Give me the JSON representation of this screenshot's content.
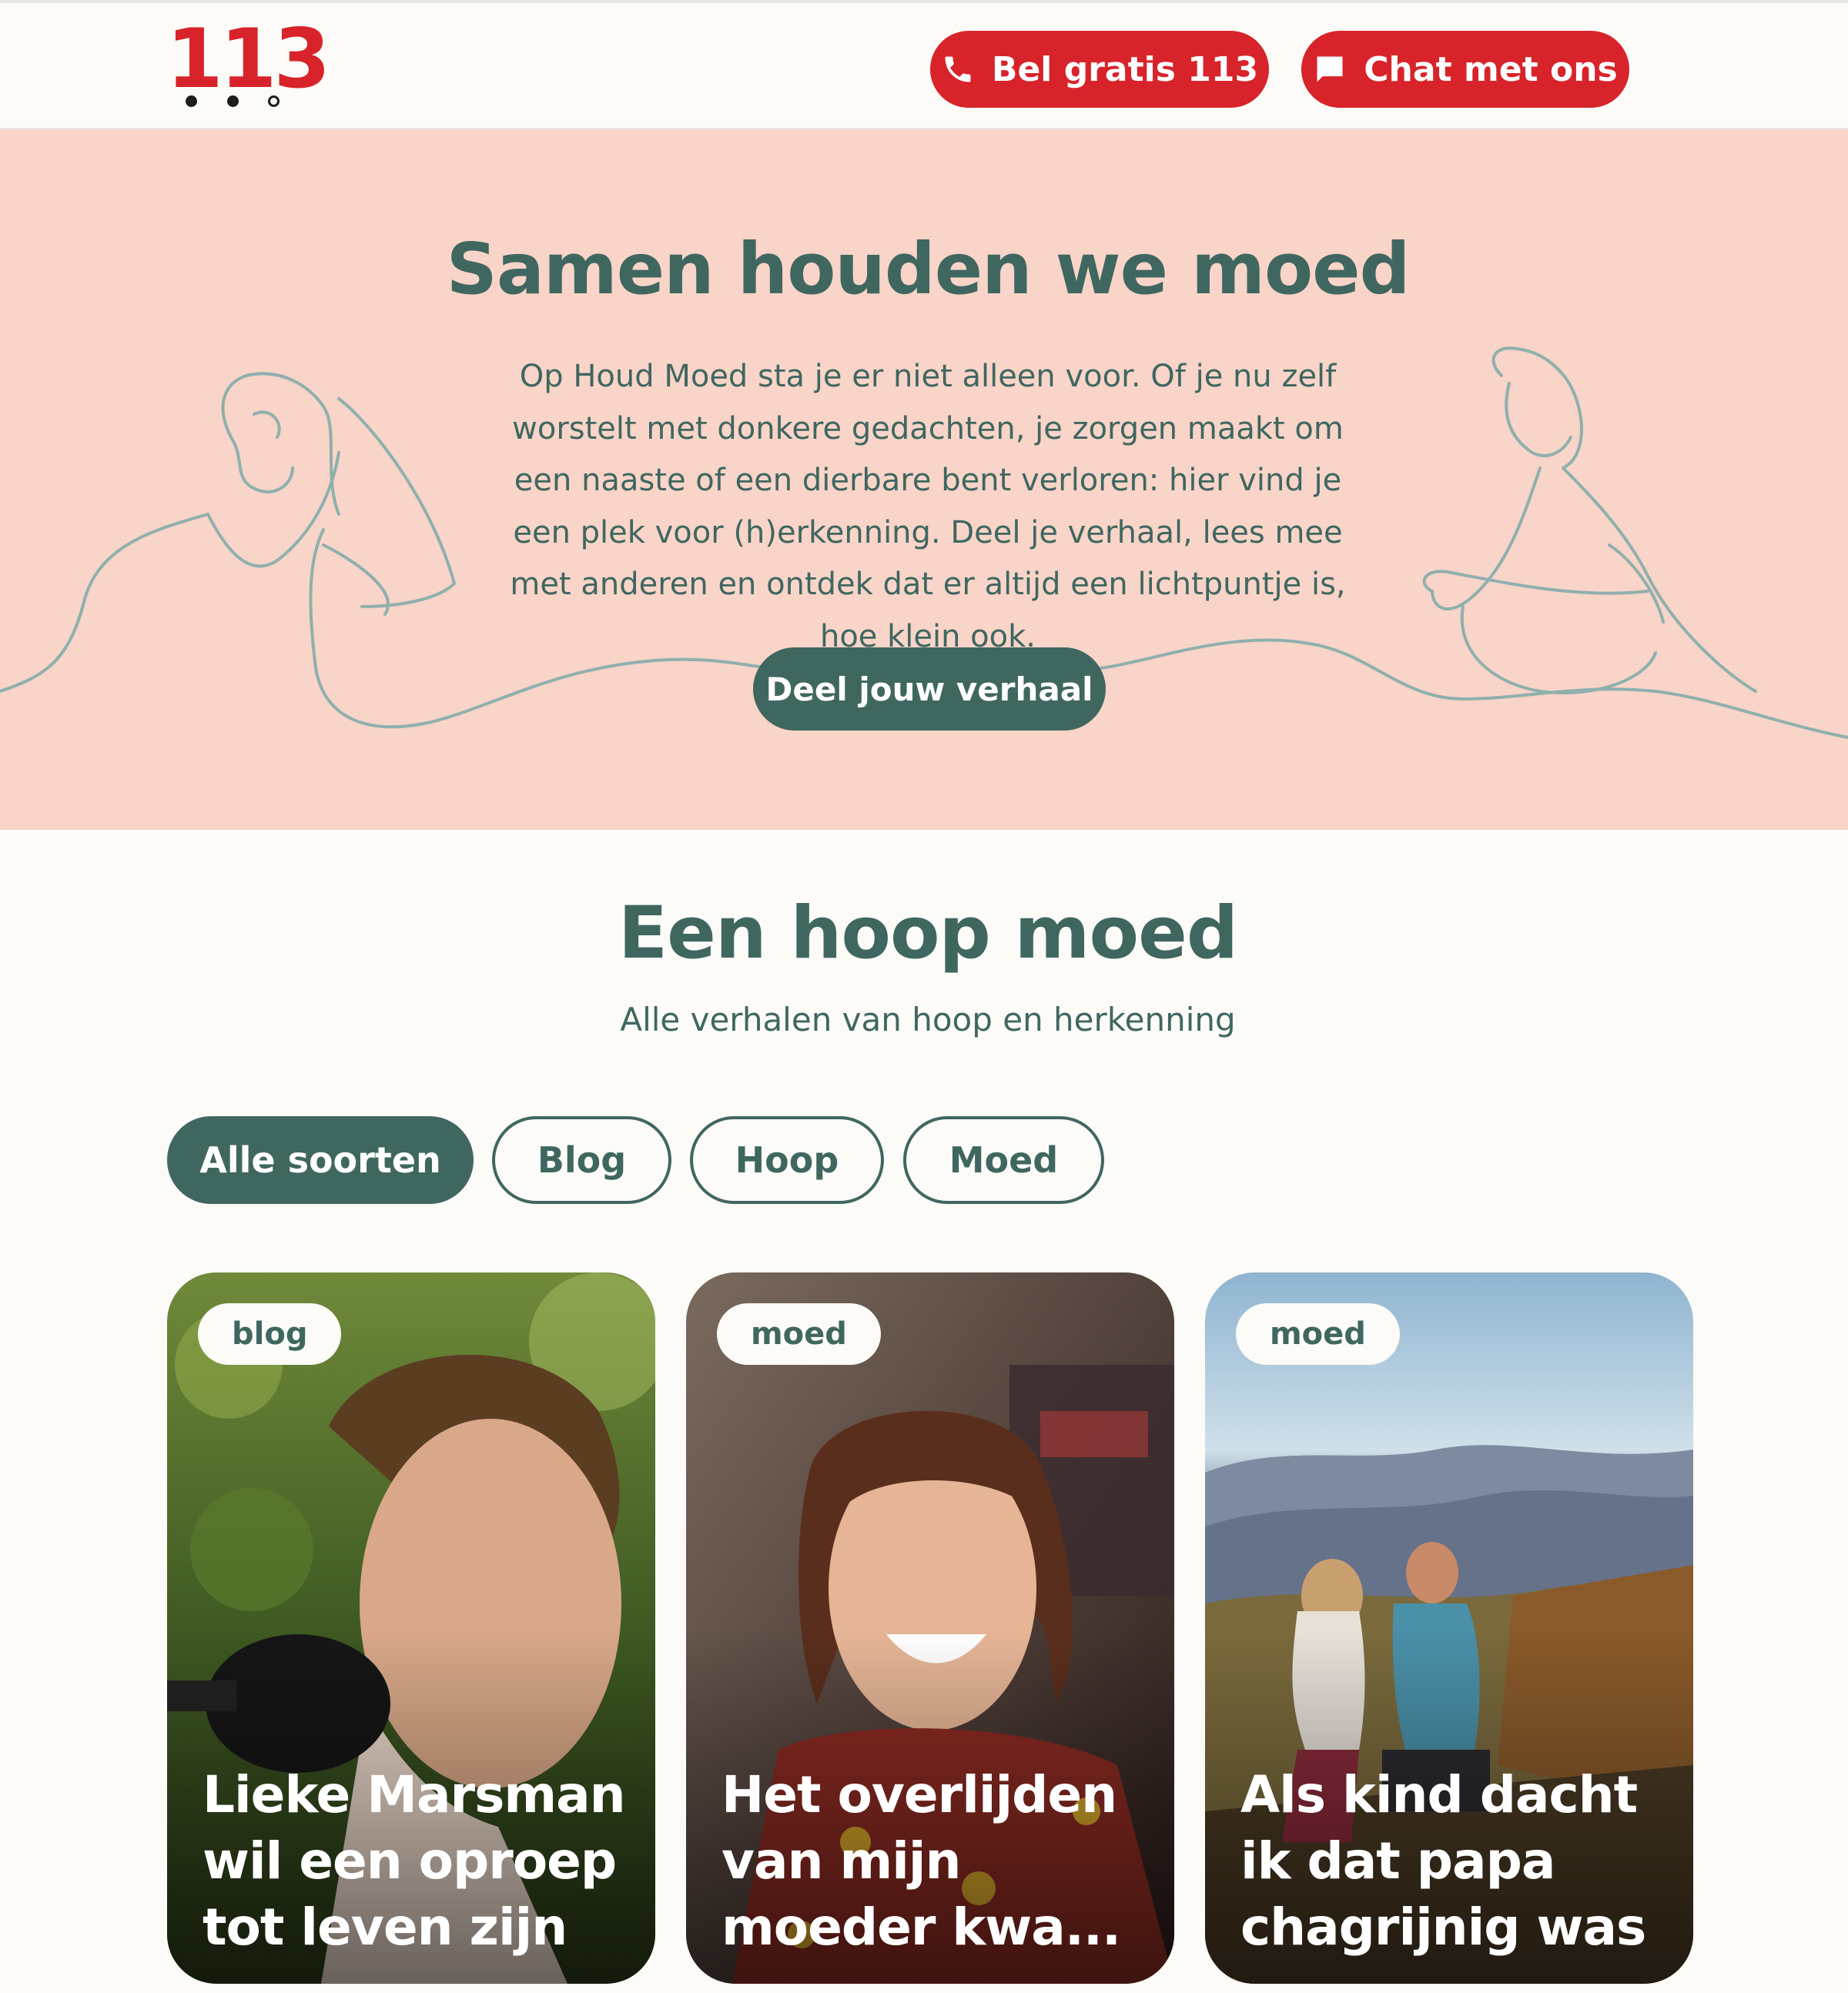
{
  "header": {
    "logo_text": "113",
    "call_label": "Bel gratis 113",
    "call_icon": "phone-icon",
    "chat_label": "Chat met ons",
    "chat_icon": "chat-bubble-icon",
    "brand_red": "#d8232a"
  },
  "hero": {
    "title": "Samen houden we moed",
    "text": "Op Houd Moed sta je er niet alleen voor. Of je nu zelf worstelt met donkere gedachten, je zorgen maakt om een naaste of een dierbare bent verloren: hier vind je een plek voor (h)erkenning. Deel je verhaal, lees mee met anderen en ontdek dat er altijd een lichtpuntje is, hoe klein ook.",
    "button_label": "Deel jouw verhaal",
    "background": "#f9d4c8"
  },
  "stories": {
    "title": "Een hoop moed",
    "subtitle": "Alle verhalen van hoop en herkenning",
    "filters": [
      {
        "label": "Alle soorten",
        "active": true
      },
      {
        "label": "Blog",
        "active": false
      },
      {
        "label": "Hoop",
        "active": false
      },
      {
        "label": "Moed",
        "active": false
      }
    ],
    "cards": [
      {
        "tag": "blog",
        "title": "Lieke Marsman wil een oproep tot leven zijn"
      },
      {
        "tag": "moed",
        "title": "Het overlijden van mijn moeder kwa..."
      },
      {
        "tag": "moed",
        "title": "Als kind dacht ik dat papa chagrijnig was"
      }
    ],
    "accent": "#3f6760"
  }
}
